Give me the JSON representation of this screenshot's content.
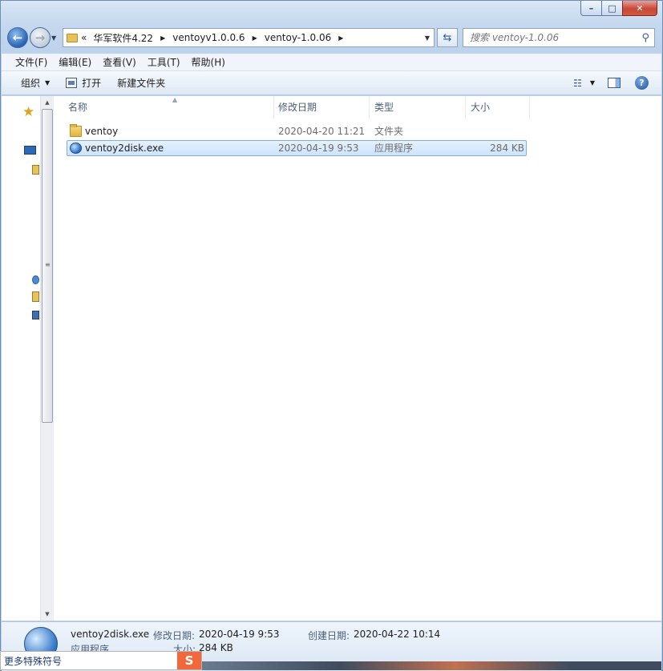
{
  "window": {
    "caption_buttons": {
      "minimize": "–",
      "maximize": "□",
      "close": "✕"
    }
  },
  "nav": {
    "back_glyph": "←",
    "forward_glyph": "→",
    "breadcrumb_overflow": "«",
    "breadcrumbs": [
      "华军软件4.22",
      "ventoyv1.0.0.6",
      "ventoy-1.0.06"
    ],
    "search_placeholder": "搜索 ventoy-1.0.06"
  },
  "menu": [
    "文件(F)",
    "编辑(E)",
    "查看(V)",
    "工具(T)",
    "帮助(H)"
  ],
  "commands": {
    "organize": "组织",
    "open": "打开",
    "new_folder": "新建文件夹"
  },
  "columns": {
    "name": "名称",
    "date": "修改日期",
    "type": "类型",
    "size": "大小"
  },
  "files": [
    {
      "name": "ventoy",
      "date": "2020-04-20 11:21",
      "type": "文件夹",
      "size": "",
      "icon": "folder-icon",
      "selected": false
    },
    {
      "name": "ventoy2disk.exe",
      "date": "2020-04-19 9:53",
      "type": "应用程序",
      "size": "284 KB",
      "icon": "exe-icon",
      "selected": true
    }
  ],
  "details": {
    "name": "ventoy2disk.exe",
    "modified_label": "修改日期:",
    "modified_value": "2020-04-19 9:53",
    "created_label": "创建日期:",
    "created_value": "2020-04-22 10:14",
    "type_value": "应用程序",
    "size_label": "大小:",
    "size_value": "284 KB"
  },
  "ime": {
    "text": "更多特殊符号",
    "logo": "S"
  },
  "colors": {
    "selection_fill": "#cde3fb",
    "selection_border": "#84acdd",
    "chrome_blue": "#c5d8ee"
  }
}
